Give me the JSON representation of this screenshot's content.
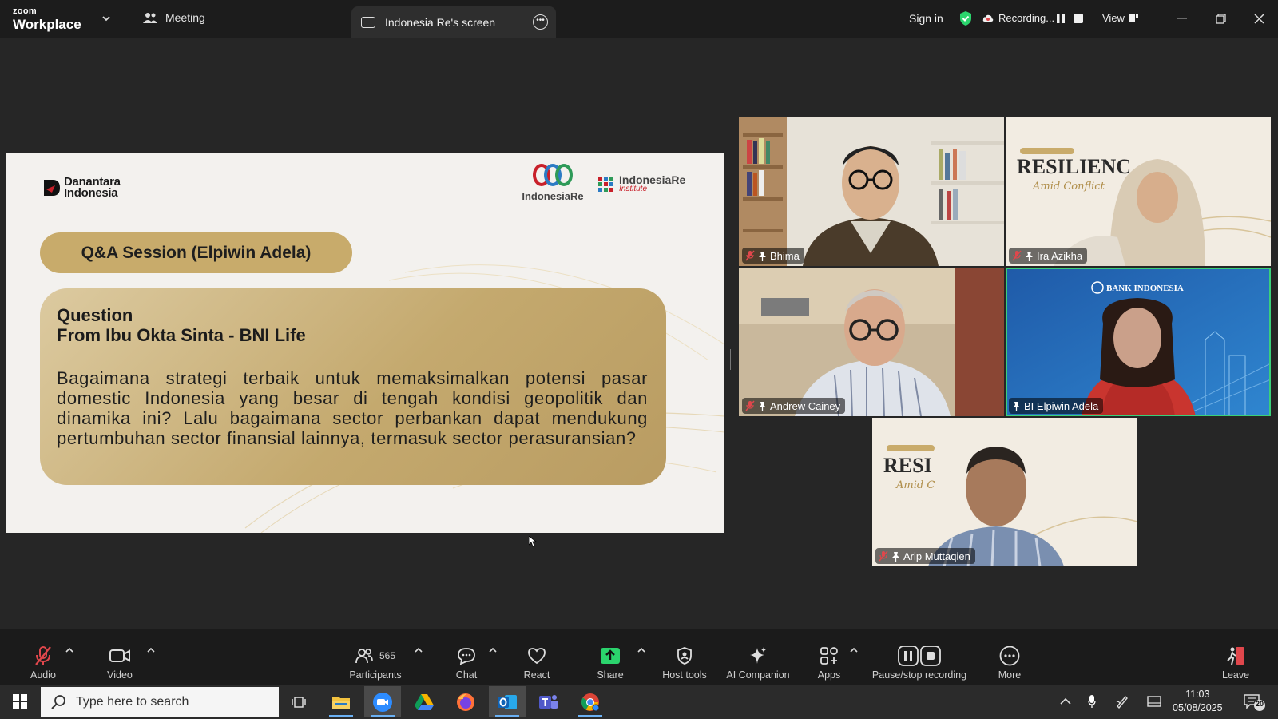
{
  "titlebar": {
    "brand_small": "zoom",
    "brand_large": "Workplace",
    "meeting_tab": "Meeting",
    "screen_tab": "Indonesia Re's screen",
    "sign_in": "Sign in",
    "recording": "Recording...",
    "view": "View"
  },
  "slide": {
    "logo_danantara_line1": "Danantara",
    "logo_danantara_line2": "Indonesia",
    "logo_indonesiare": "IndonesiaRe",
    "logo_institute_line1": "IndonesiaRe",
    "logo_institute_line2": "Institute",
    "session_title": "Q&A Session (Elpiwin Adela)",
    "question_heading": "Question",
    "question_from": "From Ibu Okta Sinta - BNI Life",
    "question_body": "Bagaimana strategi terbaik untuk memaksimalkan potensi pasar domestic Indonesia yang besar di tengah kondisi geopolitik dan dinamika ini? Lalu bagaimana sector perbankan dapat mendukung pertumbuhan sector finansial lainnya, termasuk sector perasuransian?"
  },
  "participants_tiles": [
    {
      "name": "Bhima"
    },
    {
      "name": "Ira Azikha",
      "banner_line1": "RESILIENC",
      "banner_line2": "Amid Conflict"
    },
    {
      "name": "Andrew Cainey"
    },
    {
      "name": "BI Elpiwin Adela",
      "banner_line1": "BANK INDONESIA"
    },
    {
      "name": "Arip Muttaqien",
      "banner_line1": "RESI",
      "banner_line2": "Amid C"
    }
  ],
  "toolbar": {
    "audio": "Audio",
    "video": "Video",
    "participants": "Participants",
    "participants_count": "565",
    "chat": "Chat",
    "react": "React",
    "share": "Share",
    "host_tools": "Host tools",
    "ai_companion": "AI Companion",
    "apps": "Apps",
    "pause_stop": "Pause/stop recording",
    "more": "More",
    "leave": "Leave"
  },
  "taskbar": {
    "search_placeholder": "Type here to search",
    "time": "11:03",
    "date": "05/08/2025",
    "notification_count": "20"
  },
  "colors": {
    "accent_green": "#3ad07a",
    "share_green": "#2bd46d",
    "pill_gold": "#c8ab6b",
    "mic_red": "#e0474c"
  }
}
